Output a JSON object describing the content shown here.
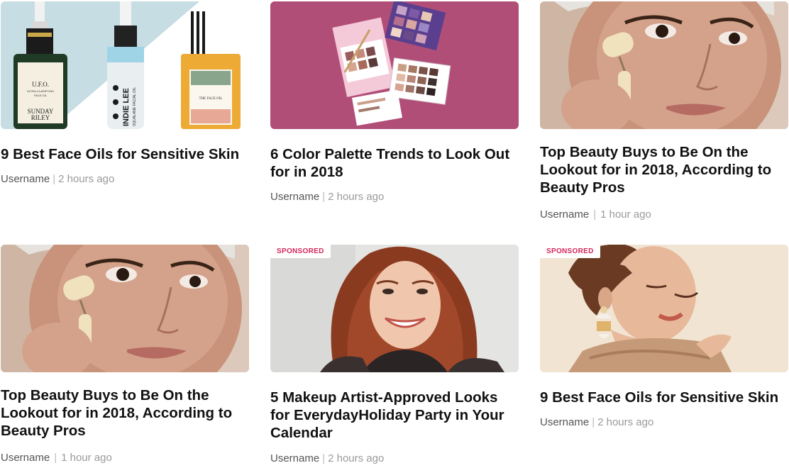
{
  "articles": [
    {
      "title": "9 Best Face Oils for Sensitive Skin",
      "author": "Username",
      "separator": "|",
      "time": "2 hours ago",
      "sponsored": false,
      "image": "face-oils-bottles",
      "product_text": {
        "b1_line1": "U.F.O.",
        "b1_line2": "ULTRA-CLARIFYING",
        "b1_line3": "FACE OIL",
        "b1_brand1": "SUNDAY",
        "b1_brand2": "RILEY",
        "b2_brand": "INDIE LEE",
        "b2_sub": "SQUALANE FACIAL OIL",
        "b3_label": "THE FACE OIL"
      }
    },
    {
      "title": "6 Color Palette Trends to Look Out for in 2018",
      "author": "Username",
      "separator": "|",
      "time": "2 hours ago",
      "sponsored": false,
      "image": "eyeshadow-palettes"
    },
    {
      "title": "Top Beauty Buys to Be On the Lookout for in 2018, According to Beauty Pros",
      "author": "Username",
      "separator": "|",
      "time": "1 hour ago",
      "sponsored": false,
      "image": "jade-roller-woman"
    },
    {
      "title": "Top Beauty Buys to Be On the Lookout for in 2018, According to Beauty Pros",
      "author": "Username",
      "separator": "|",
      "time": "1 hour ago",
      "sponsored": false,
      "image": "jade-roller-woman"
    },
    {
      "title": "5 Makeup Artist-Approved Looks for EverydayHoliday Party in Your Calendar",
      "author": "Username",
      "separator": "|",
      "time": "2 hours ago",
      "sponsored": true,
      "badge": "SPONSORED",
      "image": "smiling-redhead"
    },
    {
      "title": "9 Best Face Oils for Sensitive Skin",
      "author": "Username",
      "separator": "|",
      "time": "2 hours ago",
      "sponsored": true,
      "badge": "SPONSORED",
      "image": "woman-with-earring"
    }
  ],
  "colors": {
    "title": "#111111",
    "author": "#555555",
    "time": "#9a9a9a",
    "badge": "#d6265c"
  }
}
